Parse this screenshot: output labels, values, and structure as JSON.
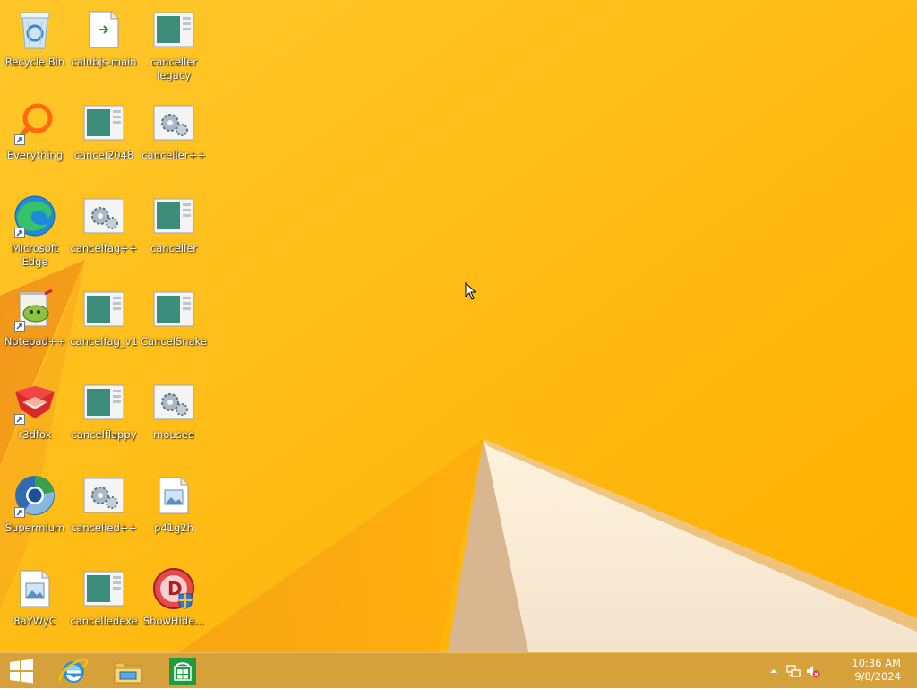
{
  "desktop": {
    "icons": [
      {
        "label": "Recycle Bin",
        "icon": "recycle-bin-icon"
      },
      {
        "label": "calubjs-main",
        "icon": "script-file-icon"
      },
      {
        "label": "canceller legacy",
        "icon": "app-window-icon"
      },
      {
        "label": "Everything",
        "icon": "everything-search-icon"
      },
      {
        "label": "cancel2048",
        "icon": "app-window-icon"
      },
      {
        "label": "canceller++",
        "icon": "settings-gears-icon"
      },
      {
        "label": "Microsoft Edge",
        "icon": "edge-browser-icon"
      },
      {
        "label": "cancelfag++",
        "icon": "settings-gears-icon"
      },
      {
        "label": "canceller",
        "icon": "app-window-icon"
      },
      {
        "label": "Notepad++",
        "icon": "notepad-plus-plus-icon"
      },
      {
        "label": "cancelfag_v1",
        "icon": "app-window-icon"
      },
      {
        "label": "CancelSnake",
        "icon": "app-window-icon"
      },
      {
        "label": "r3dfox",
        "icon": "r3dfox-browser-icon"
      },
      {
        "label": "cancelflappy",
        "icon": "app-window-icon"
      },
      {
        "label": "mousee",
        "icon": "settings-gears-icon"
      },
      {
        "label": "Supermium",
        "icon": "supermium-browser-icon"
      },
      {
        "label": "cancelled++",
        "icon": "settings-gears-icon"
      },
      {
        "label": "p41g2h",
        "icon": "image-file-icon"
      },
      {
        "label": "8aYWyC",
        "icon": "image-file-icon"
      },
      {
        "label": "cancelledexe",
        "icon": "app-window-icon"
      },
      {
        "label": "ShowHide...",
        "icon": "showhide-shield-icon"
      }
    ]
  },
  "taskbar": {
    "start": {
      "icon": "windows-logo-icon"
    },
    "pinned": [
      {
        "icon": "internet-explorer-icon"
      },
      {
        "icon": "file-explorer-icon"
      },
      {
        "icon": "windows-store-icon"
      }
    ],
    "tray": {
      "icons": [
        "show-hidden-icons-chevron-icon",
        "network-icon",
        "volume-muted-icon"
      ],
      "time": "10:36 AM",
      "date": "9/8/2024"
    }
  },
  "colors": {
    "wallpaper": "#ffb400",
    "taskbar": "#d6a03a"
  }
}
